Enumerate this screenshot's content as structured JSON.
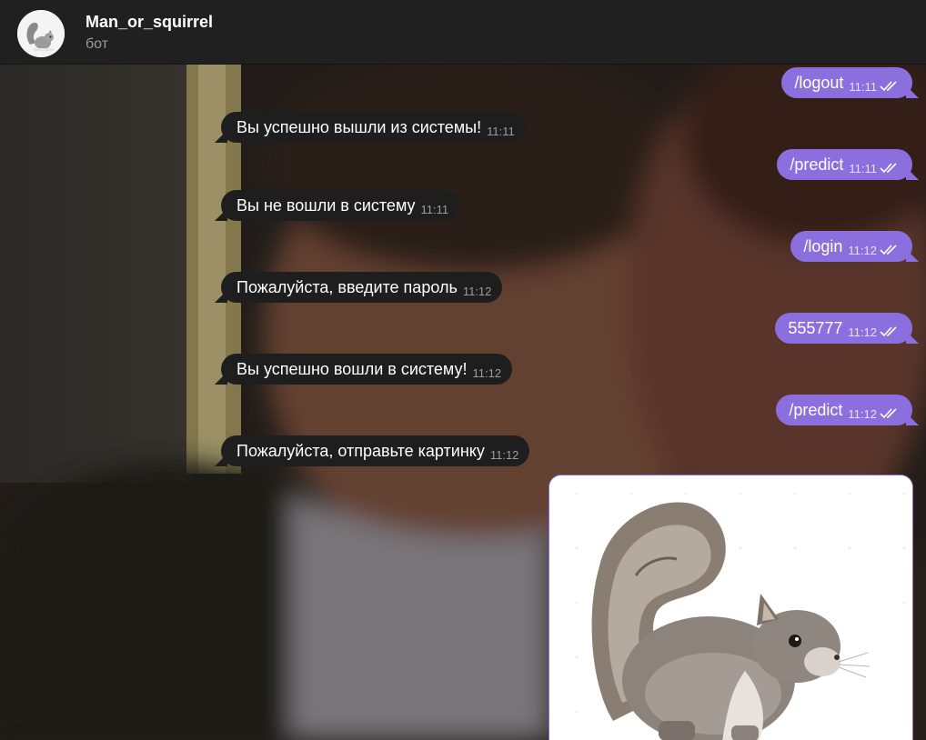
{
  "header": {
    "title": "Man_or_squirrel",
    "subtitle": "бот"
  },
  "messages": [
    {
      "text": "/logout",
      "time": "11:11",
      "direction": "out"
    },
    {
      "text": "Вы успешно вышли из системы!",
      "time": "11:11",
      "direction": "in"
    },
    {
      "text": "/predict",
      "time": "11:11",
      "direction": "out"
    },
    {
      "text": "Вы не вошли в систему",
      "time": "11:11",
      "direction": "in"
    },
    {
      "text": "/login",
      "time": "11:12",
      "direction": "out"
    },
    {
      "text": "Пожалуйста, введите пароль",
      "time": "11:12",
      "direction": "in"
    },
    {
      "text": "555777",
      "time": "11:12",
      "direction": "out"
    },
    {
      "text": "Вы успешно вошли в систему!",
      "time": "11:12",
      "direction": "in"
    },
    {
      "text": "/predict",
      "time": "11:12",
      "direction": "out"
    },
    {
      "text": "Пожалуйста, отправьте картинку",
      "time": "11:12",
      "direction": "in"
    }
  ],
  "colors": {
    "outgoing_bubble": "#8c6fde",
    "incoming_bubble": "#1e1e1e",
    "header_bg": "#202021"
  },
  "icons": {
    "read_status": "double-check-icon",
    "avatar": "squirrel-avatar",
    "attachment": "squirrel-photo"
  }
}
